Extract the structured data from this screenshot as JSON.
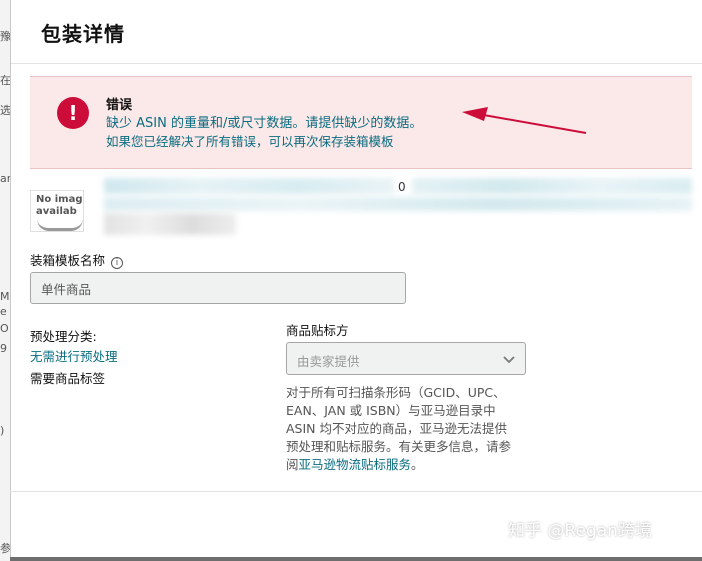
{
  "background": {
    "fragments": [
      "豫",
      "在",
      "选",
      "an",
      "Me",
      "e",
      "O",
      "9",
      ")",
      "参"
    ]
  },
  "modal": {
    "title": "包装详情"
  },
  "error": {
    "icon": "exclamation-icon",
    "title": "错误",
    "message": "缺少 ASIN 的重量和/或尺寸数据。请提供缺少的数据。",
    "hint": "如果您已经解决了所有错误，可以再次保存装箱模板"
  },
  "product": {
    "no_image_line1": "No image",
    "no_image_line2": "availab",
    "digit_fragment": "0"
  },
  "template": {
    "label": "装箱模板名称",
    "value": "单件商品"
  },
  "prep": {
    "label": "预处理分类:",
    "link": "无需进行预处理",
    "need_label": "需要商品标签"
  },
  "labeling": {
    "label": "商品贴标方",
    "selected": "由卖家提供",
    "desc_lines": [
      "对于所有可扫描条形码（GCID、UPC、",
      "EAN、JAN 或 ISBN）与亚马逊目录中",
      "ASIN 均不对应的商品，亚马逊无法提供",
      "预处理和贴标服务。有关更多信息，请参"
    ],
    "desc_prefix": "阅",
    "desc_link": "亚马逊物流贴标服务",
    "desc_suffix": "。"
  },
  "watermark": "知乎 @Regan跨境",
  "colors": {
    "error_bg": "#fbe8e8",
    "error_icon": "#cc0c39",
    "link": "#0a6c80",
    "arrow": "#cc0c39"
  }
}
